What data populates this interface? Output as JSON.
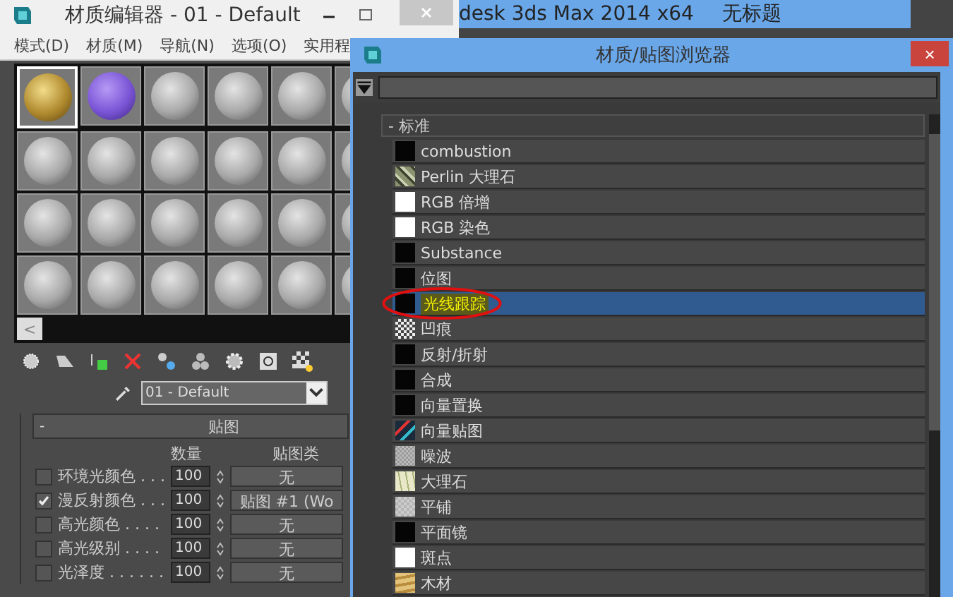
{
  "main_window": {
    "title": "desk 3ds Max  2014 x64",
    "document": "无标题"
  },
  "material_editor": {
    "title": "材质编辑器 - 01 - Default",
    "menu": [
      "模式(D)",
      "材质(M)",
      "导航(N)",
      "选项(O)",
      "实用程"
    ],
    "slots": [
      {
        "kind": "gold",
        "selected": true
      },
      {
        "kind": "purple",
        "selected": false
      },
      {
        "kind": "gray",
        "selected": false
      },
      {
        "kind": "gray",
        "selected": false
      },
      {
        "kind": "gray",
        "selected": false
      },
      {
        "kind": "gray",
        "selected": false
      },
      {
        "kind": "gray",
        "selected": false
      },
      {
        "kind": "gray",
        "selected": false
      },
      {
        "kind": "gray",
        "selected": false
      },
      {
        "kind": "gray",
        "selected": false
      },
      {
        "kind": "gray",
        "selected": false
      },
      {
        "kind": "gray",
        "selected": false
      },
      {
        "kind": "gray",
        "selected": false
      },
      {
        "kind": "gray",
        "selected": false
      },
      {
        "kind": "gray",
        "selected": false
      },
      {
        "kind": "gray",
        "selected": false
      },
      {
        "kind": "gray",
        "selected": false
      },
      {
        "kind": "gray",
        "selected": false
      },
      {
        "kind": "gray",
        "selected": false
      },
      {
        "kind": "gray",
        "selected": false
      },
      {
        "kind": "gray",
        "selected": false
      },
      {
        "kind": "gray",
        "selected": false
      },
      {
        "kind": "gray",
        "selected": false
      },
      {
        "kind": "gray",
        "selected": false
      }
    ],
    "scroll_left": "<",
    "material_name": "01 - Default",
    "maps_rollout": {
      "title": "贴图",
      "collapse": "-",
      "columns": [
        "数量",
        "贴图类"
      ],
      "rows": [
        {
          "label": "环境光颜色 . . .",
          "checked": false,
          "amount": "100",
          "map": "无"
        },
        {
          "label": "漫反射颜色 . . .",
          "checked": true,
          "amount": "100",
          "map": "贴图 #1 (Wo"
        },
        {
          "label": "高光颜色 . . . .",
          "checked": false,
          "amount": "100",
          "map": "无"
        },
        {
          "label": "高光级别 . . . .",
          "checked": false,
          "amount": "100",
          "map": "无"
        },
        {
          "label": "光泽度 . . . . . .",
          "checked": false,
          "amount": "100",
          "map": "无"
        }
      ]
    }
  },
  "browser": {
    "title": "材质/贴图浏览器",
    "close": "×",
    "group": {
      "collapse": "-",
      "title": "标准",
      "expanded": true
    },
    "items": [
      {
        "label": "combustion",
        "kind": "black",
        "selected": false,
        "circled": false
      },
      {
        "label": "Perlin 大理石",
        "kind": "perlin",
        "selected": false,
        "circled": false
      },
      {
        "label": "RGB 倍增",
        "kind": "white",
        "selected": false,
        "circled": false
      },
      {
        "label": "RGB 染色",
        "kind": "white",
        "selected": false,
        "circled": false
      },
      {
        "label": "Substance",
        "kind": "black",
        "selected": false,
        "circled": false
      },
      {
        "label": "位图",
        "kind": "black",
        "selected": false,
        "circled": false
      },
      {
        "label": "光线跟踪",
        "kind": "black",
        "selected": true,
        "circled": true
      },
      {
        "label": "凹痕",
        "kind": "dent",
        "selected": false,
        "circled": false
      },
      {
        "label": "反射/折射",
        "kind": "black",
        "selected": false,
        "circled": false
      },
      {
        "label": "合成",
        "kind": "black",
        "selected": false,
        "circled": false
      },
      {
        "label": "向量置换",
        "kind": "black",
        "selected": false,
        "circled": false
      },
      {
        "label": "向量贴图",
        "kind": "vector",
        "selected": false,
        "circled": false
      },
      {
        "label": "噪波",
        "kind": "noise",
        "selected": false,
        "circled": false
      },
      {
        "label": "大理石",
        "kind": "marble",
        "selected": false,
        "circled": false
      },
      {
        "label": "平铺",
        "kind": "tiles",
        "selected": false,
        "circled": false
      },
      {
        "label": "平面镜",
        "kind": "black",
        "selected": false,
        "circled": false
      },
      {
        "label": "斑点",
        "kind": "white",
        "selected": false,
        "circled": false
      },
      {
        "label": "木材",
        "kind": "wood",
        "selected": false,
        "circled": false
      }
    ]
  }
}
